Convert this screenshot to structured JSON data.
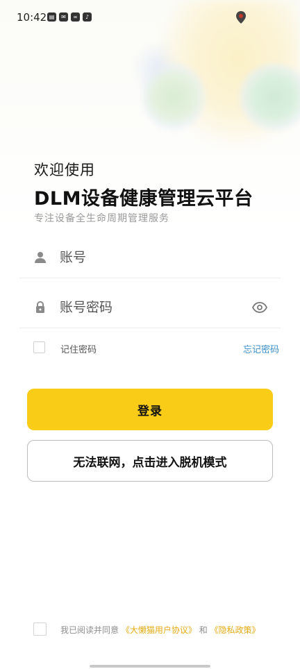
{
  "status_bar": {
    "time": "10:42",
    "icons": [
      "mail-box-icon",
      "message-icon",
      "link-icon",
      "tiktok-icon"
    ],
    "location_icon": "location-pin-icon"
  },
  "header": {
    "welcome": "欢迎使用",
    "title": "DLM设备健康管理云平台",
    "subtitle": "专注设备全生命周期管理服务"
  },
  "form": {
    "account": {
      "placeholder": "账号",
      "value": "",
      "icon": "user-icon"
    },
    "password": {
      "placeholder": "账号密码",
      "value": "",
      "icon": "lock-icon",
      "toggle_icon": "eye-icon"
    },
    "remember_label": "记住密码",
    "remember_checked": false,
    "forgot_label": "忘记密码"
  },
  "buttons": {
    "login_label": "登录",
    "offline_label": "无法联网，点击进入脱机模式"
  },
  "agreement": {
    "checked": false,
    "prefix": "我已阅读并同意",
    "user_agreement": "《大懒猫用户协议》",
    "connector": "和",
    "privacy_policy": "《隐私政策》"
  },
  "colors": {
    "accent": "#f8cc17",
    "link_blue": "#3a8fc9",
    "link_gold": "#e5ab12"
  }
}
